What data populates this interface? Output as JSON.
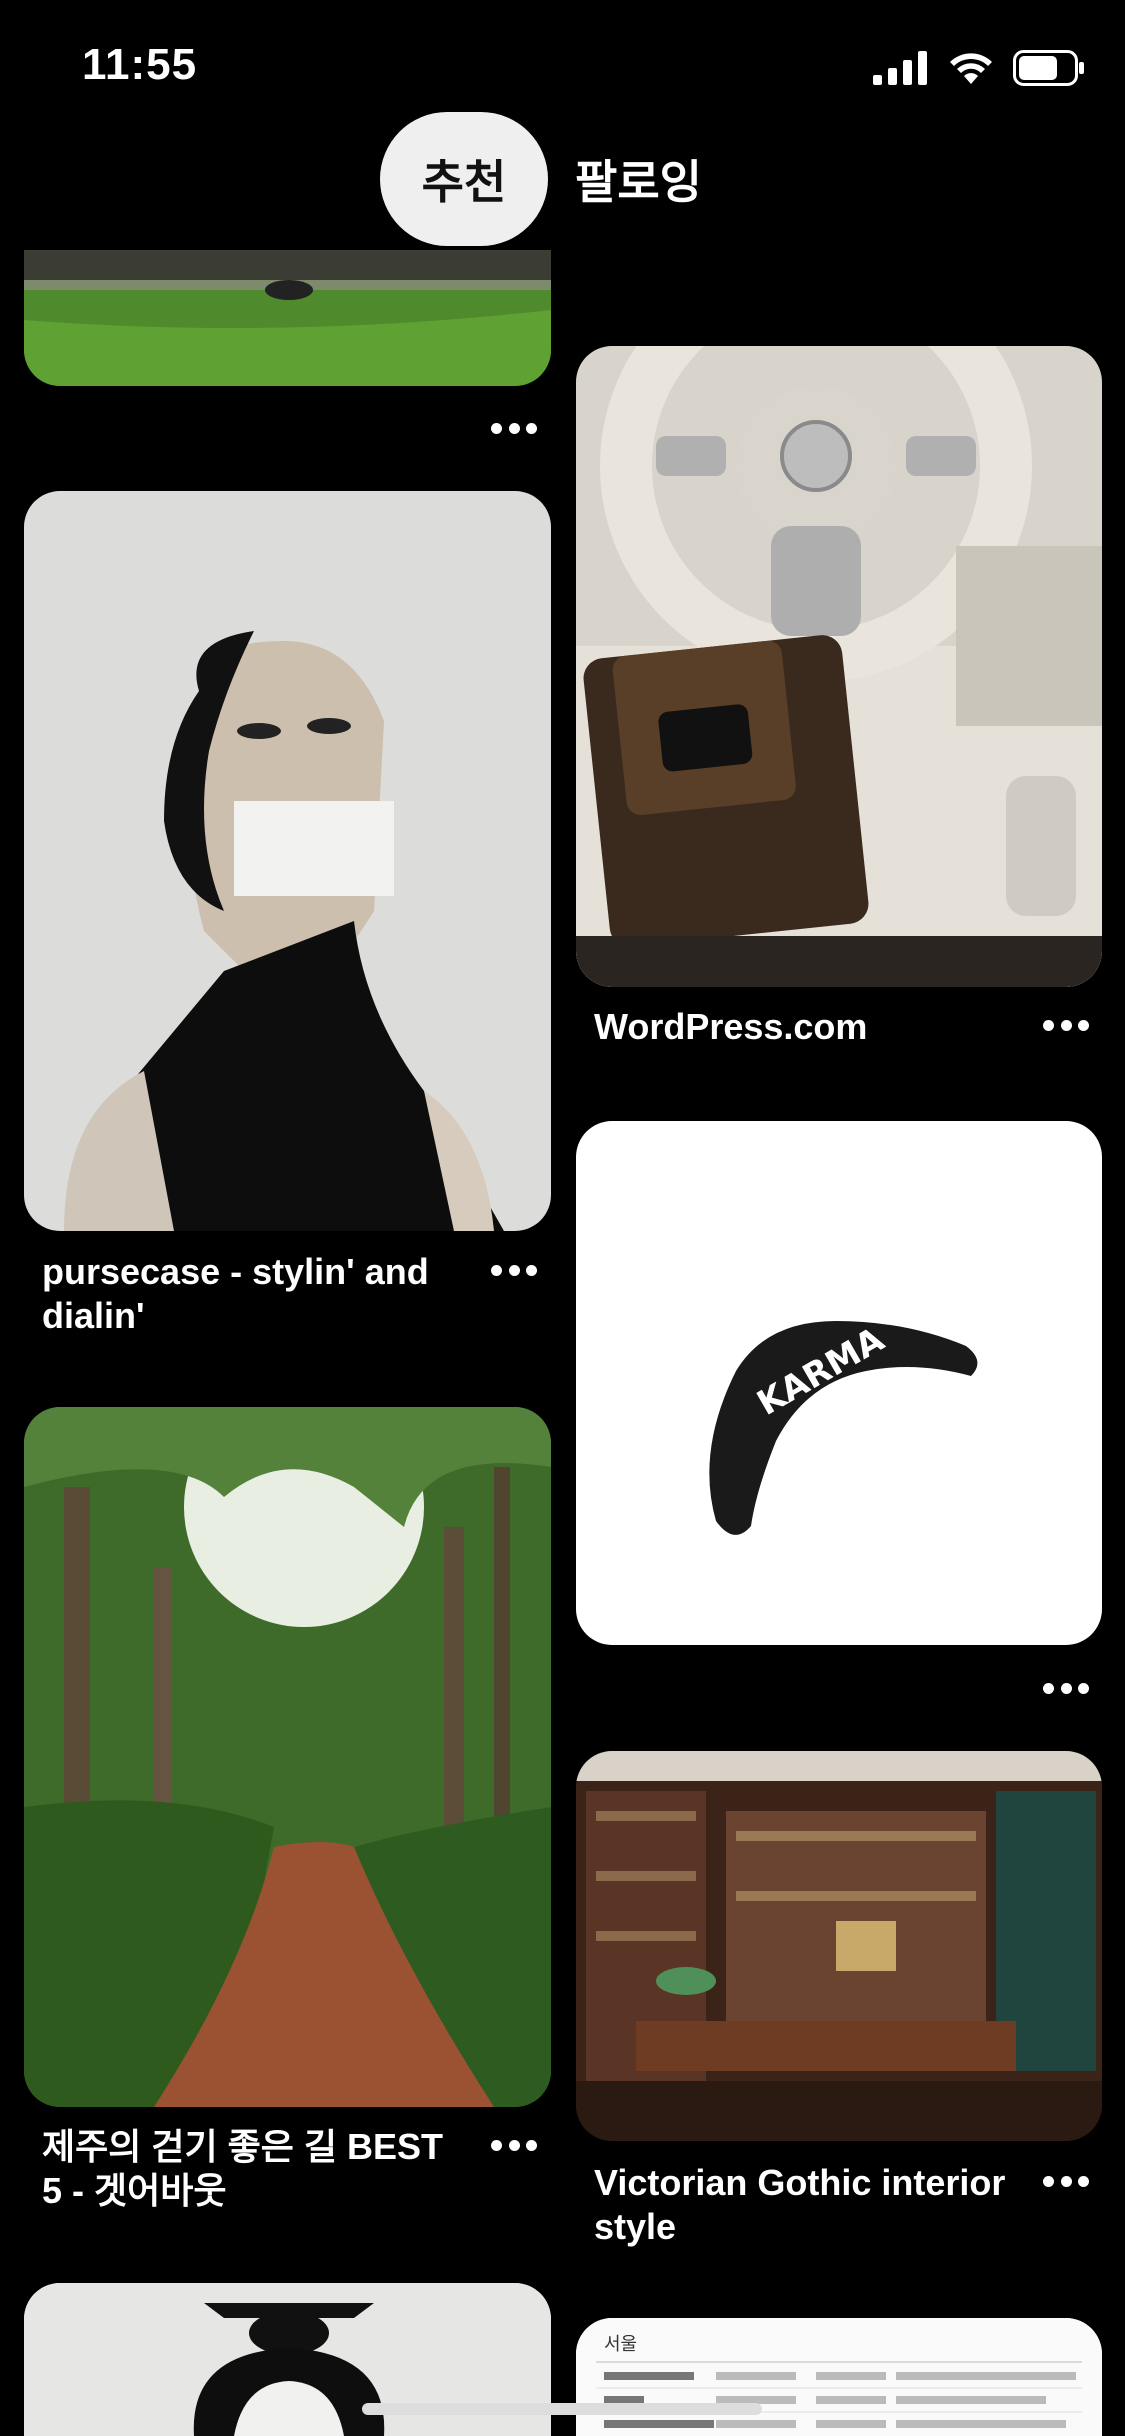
{
  "status_bar": {
    "time": "11:55"
  },
  "tabs": {
    "active": "추천",
    "other": "팔로잉"
  },
  "pins": [
    {
      "caption": "",
      "image": "car on green lawn"
    },
    {
      "caption": "WordPress.com",
      "image": "luxury car interior with monogram handbag"
    },
    {
      "caption": "pursecase - stylin' and dialin'",
      "image": "black and white body paint portrait"
    },
    {
      "caption": "",
      "image": "karma boomerang illustration",
      "image_text": "KARMA"
    },
    {
      "caption": "제주의 걷기 좋은 길 BEST 5 - 겟어바웃",
      "image": "forest path"
    },
    {
      "caption": "Victorian Gothic interior style",
      "image": "victorian library room"
    },
    {
      "caption": "",
      "image": "portrait with hair bun"
    },
    {
      "caption": "",
      "image": "korean text table document",
      "image_text": "서울"
    }
  ]
}
